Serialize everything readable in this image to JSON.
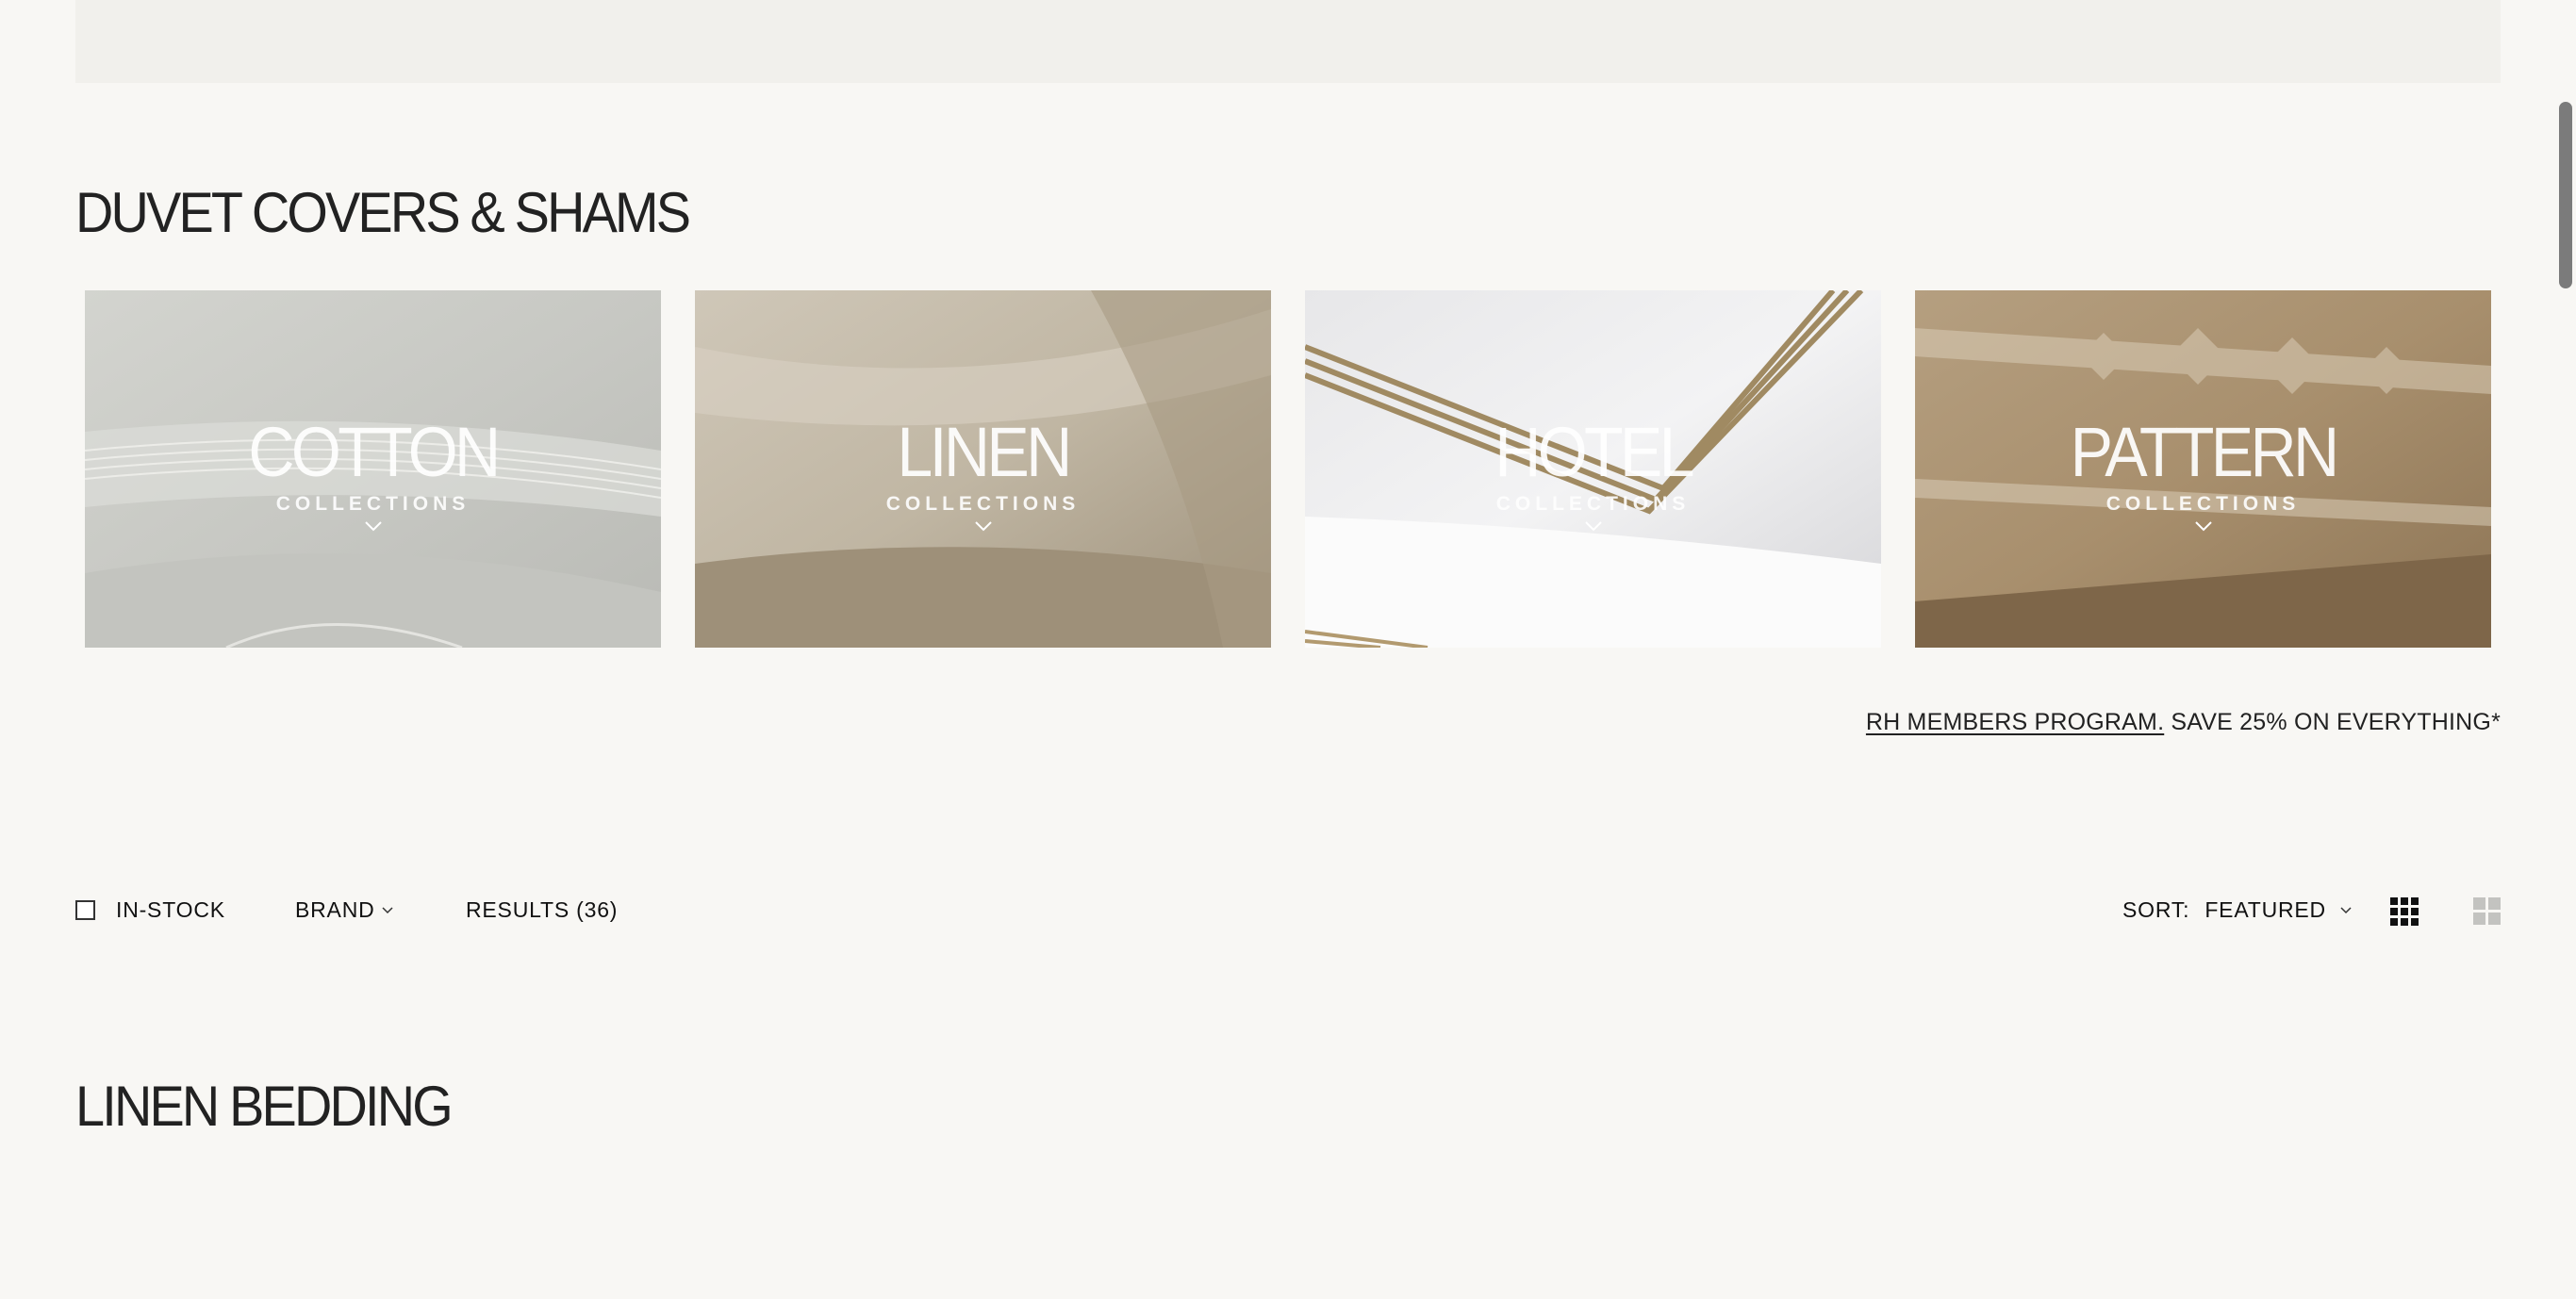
{
  "sections": {
    "duvet_title": "DUVET COVERS & SHAMS",
    "linen_title": "LINEN BEDDING"
  },
  "collections": [
    {
      "name": "COTTON",
      "sub": "COLLECTIONS"
    },
    {
      "name": "LINEN",
      "sub": "COLLECTIONS"
    },
    {
      "name": "HOTEL",
      "sub": "COLLECTIONS"
    },
    {
      "name": "PATTERN",
      "sub": "COLLECTIONS"
    }
  ],
  "promo": {
    "link": "RH MEMBERS PROGRAM.",
    "text": " SAVE 25% ON EVERYTHING*"
  },
  "filters": {
    "in_stock": "IN-STOCK",
    "brand": "BRAND",
    "results": "RESULTS (36)",
    "sort_label": "SORT:",
    "sort_value": "FEATURED"
  },
  "icons": {
    "grid_dense": "grid-3x3-icon",
    "grid_large": "grid-2x2-icon",
    "chevron": "chevron-down-icon"
  }
}
